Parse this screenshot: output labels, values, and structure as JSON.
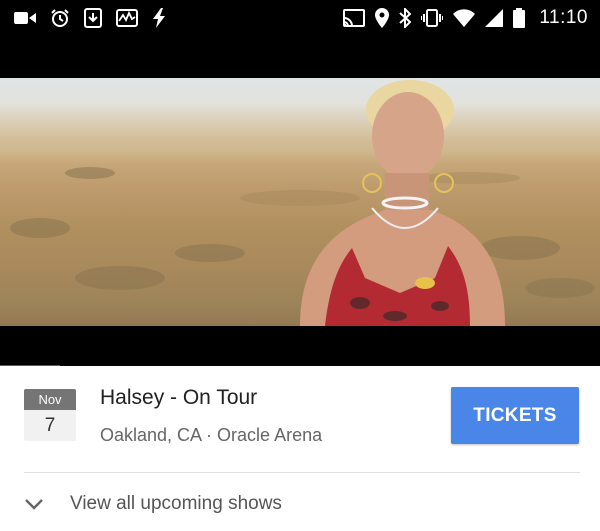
{
  "status_bar": {
    "time": "11:10",
    "left_icons": [
      "video-camera-icon",
      "alarm-clock-icon",
      "download-icon",
      "activity-monitor-icon",
      "flash-icon"
    ],
    "right_icons": [
      "cast-icon",
      "location-icon",
      "bluetooth-icon",
      "vibrate-icon",
      "wifi-icon",
      "signal-icon",
      "battery-icon"
    ]
  },
  "video": {
    "progress": 0.1
  },
  "event": {
    "month": "Nov",
    "day": "7",
    "title": "Halsey - On Tour",
    "location": "Oakland, CA · Oracle Arena",
    "tickets_label": "TICKETS",
    "view_all_label": "View all upcoming shows"
  },
  "colors": {
    "accent": "#4a86e8",
    "progress": "#e62117",
    "badge_month_bg": "#757575"
  }
}
